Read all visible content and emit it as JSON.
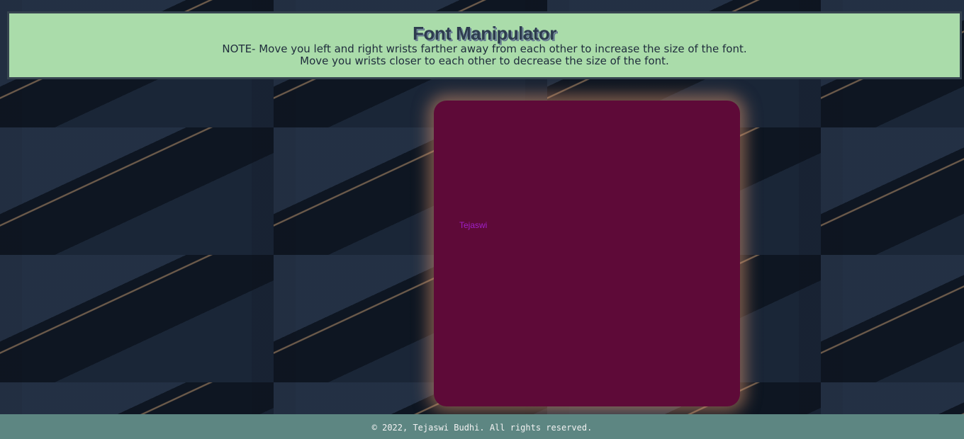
{
  "header": {
    "title": "Font Manipulator",
    "note_line1": "NOTE- Move you left and right wrists farther away from each other to increase the size of the font.",
    "note_line2": "Move you wrists closer to each other to decrease the size of the font."
  },
  "canvas": {
    "text": "Tejaswi",
    "background_color": "#5e0a38",
    "text_color": "#a020c8"
  },
  "footer": {
    "copyright": "© 2022, Tejaswi Budhi. All rights reserved."
  }
}
